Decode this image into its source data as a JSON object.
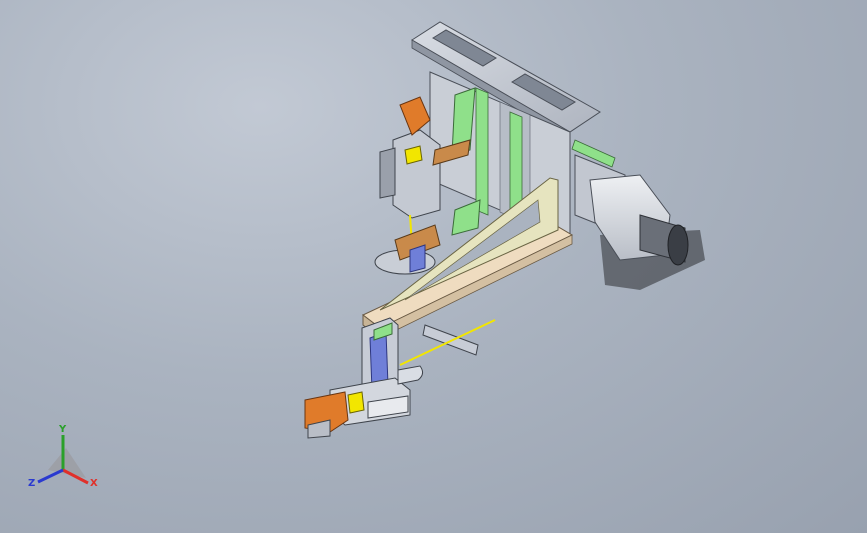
{
  "viewport": {
    "background_top": "#c2c9d4",
    "background_bottom": "#98a1af"
  },
  "model": {
    "parts": {
      "top_plate": "#c7ccd6",
      "wooden_arm": "#efdcc0",
      "green_rail": "#8fe08a",
      "orange_block": "#e07b2a",
      "blue_block": "#6f7fd8",
      "motor_body": "#d3d7de",
      "yellow_axis": "#f2e600"
    }
  },
  "triad": {
    "x_label": "X",
    "y_label": "Y",
    "z_label": "Z",
    "x_color": "#e0302a",
    "y_color": "#2aa02a",
    "z_color": "#2a3ad0"
  }
}
